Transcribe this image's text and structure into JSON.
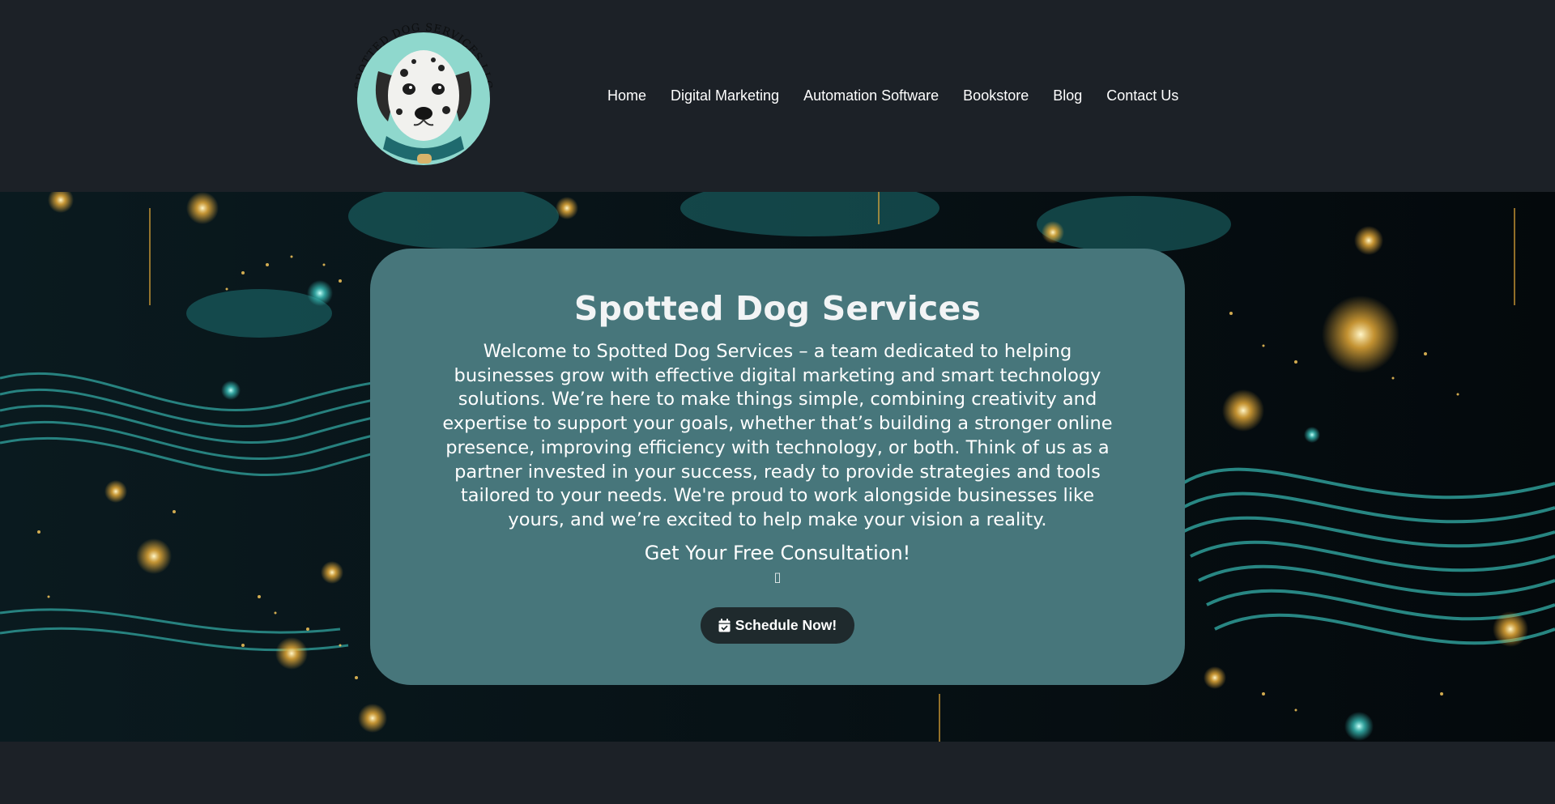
{
  "header": {
    "logo": {
      "ring_text": "SPOTTED DOG SERVICES LLC",
      "alt": "Spotted Dog Services logo"
    },
    "nav": [
      {
        "label": "Home"
      },
      {
        "label": "Digital Marketing"
      },
      {
        "label": "Automation Software"
      },
      {
        "label": "Bookstore"
      },
      {
        "label": "Blog"
      },
      {
        "label": "Contact Us"
      }
    ]
  },
  "hero": {
    "title": "Spotted Dog Services",
    "intro": "Welcome to Spotted Dog Services – a team dedicated to helping businesses grow with effective digital marketing and smart technology solutions. We’re here to make things simple, combining creativity and expertise to support your goals, whether that’s building a stronger online presence, improving efficiency with technology, or both. Think of us as a partner invested in your success, ready to provide strategies and tools tailored to your needs. We're proud to work alongside businesses like yours, and we’re excited to help make your vision a reality.",
    "cta_heading": "Get Your Free Consultation!",
    "glyph": "▯",
    "button": {
      "label": "Schedule Now!",
      "icon": "calendar-check-icon"
    }
  },
  "colors": {
    "page_bg": "#1c2127",
    "card_bg": "#47767b",
    "button_bg": "#1f2a2d",
    "accent_teal": "#3fd8d0",
    "accent_gold": "#f2b33a"
  }
}
